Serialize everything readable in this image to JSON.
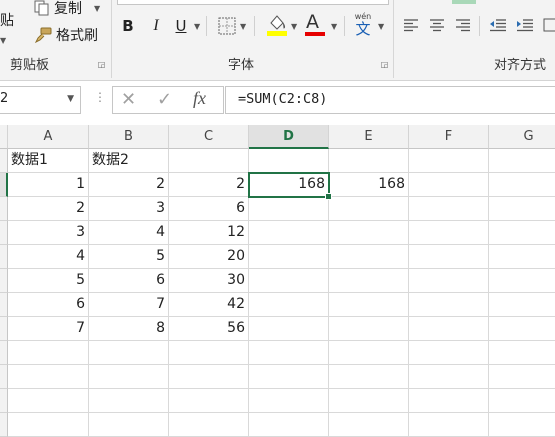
{
  "ribbon": {
    "clipboard": {
      "paste_label": "粘贴",
      "copy_label": "复制",
      "format_painter_label": "格式刷",
      "group_label": "剪贴板"
    },
    "font": {
      "bold": "B",
      "italic": "I",
      "underline": "U",
      "font_color_glyph": "A",
      "phonetic_top": "wén",
      "phonetic_char": "文",
      "group_label": "字体",
      "fill_color": "#ffff00",
      "font_color": "#e60000"
    },
    "alignment": {
      "group_label": "对齐方式"
    }
  },
  "formula_bar": {
    "name_box_value": "2",
    "fx_label": "fx",
    "formula": "=SUM(C2:C8)"
  },
  "sheet": {
    "columns": [
      "A",
      "B",
      "C",
      "D",
      "E",
      "F",
      "G"
    ],
    "selected_column": "D",
    "rows": [
      [
        "数据1",
        "数据2",
        "",
        "",
        "",
        "",
        ""
      ],
      [
        "1",
        "2",
        "2",
        "168",
        "168",
        "",
        ""
      ],
      [
        "2",
        "3",
        "6",
        "",
        "",
        "",
        ""
      ],
      [
        "3",
        "4",
        "12",
        "",
        "",
        "",
        ""
      ],
      [
        "4",
        "5",
        "20",
        "",
        "",
        "",
        ""
      ],
      [
        "5",
        "6",
        "30",
        "",
        "",
        "",
        ""
      ],
      [
        "6",
        "7",
        "42",
        "",
        "",
        "",
        ""
      ],
      [
        "7",
        "8",
        "56",
        "",
        "",
        "",
        ""
      ],
      [
        "",
        "",
        "",
        "",
        "",
        "",
        ""
      ],
      [
        "",
        "",
        "",
        "",
        "",
        "",
        ""
      ],
      [
        "",
        "",
        "",
        "",
        "",
        "",
        ""
      ],
      [
        "",
        "",
        "",
        "",
        "",
        "",
        ""
      ]
    ],
    "active_cell": {
      "row": 1,
      "col": 3
    },
    "accent_color": "#217346"
  }
}
